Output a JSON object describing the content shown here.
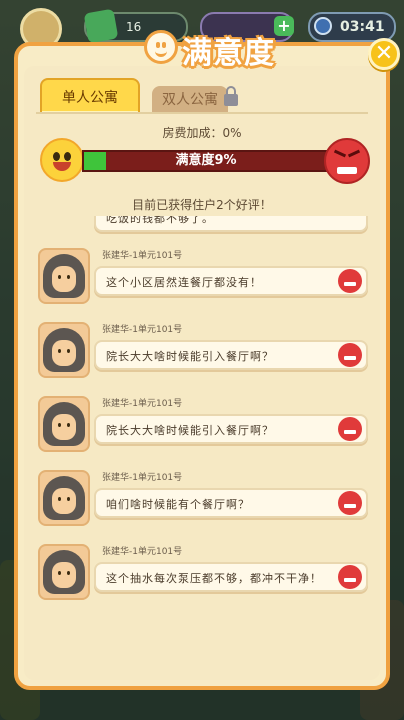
{
  "hud": {
    "cash_value": "16",
    "time": "03:41"
  },
  "dialog": {
    "title": "满意度",
    "close_label": "✕"
  },
  "tabs": [
    {
      "label": "单人公寓",
      "active": true
    },
    {
      "label": "双人公寓",
      "active": false,
      "locked": true
    }
  ],
  "bonus_text": "房费加成：0%",
  "satisfaction": {
    "label": "满意度9%",
    "percent": 9
  },
  "reviews_summary": "目前已获得住户2个好评！",
  "reviews": [
    {
      "name": "",
      "message": "吃饭的钱都不够了。",
      "sentiment": "angry",
      "partial": true
    },
    {
      "name": "张建华-1单元101号",
      "message": "这个小区居然连餐厅都没有！",
      "sentiment": "angry"
    },
    {
      "name": "张建华-1单元101号",
      "message": "院长大大啥时候能引入餐厅啊？",
      "sentiment": "angry"
    },
    {
      "name": "张建华-1单元101号",
      "message": "院长大大啥时候能引入餐厅啊？",
      "sentiment": "angry"
    },
    {
      "name": "张建华-1单元101号",
      "message": "咱们啥时候能有个餐厅啊？",
      "sentiment": "angry"
    },
    {
      "name": "张建华-1单元101号",
      "message": "这个抽水每次泵压都不够，都冲不干净！",
      "sentiment": "angry"
    }
  ],
  "colors": {
    "panel_border": "#f0a241",
    "bar_fill": "#3fc43b",
    "bar_bg": "#7b1e1b"
  }
}
